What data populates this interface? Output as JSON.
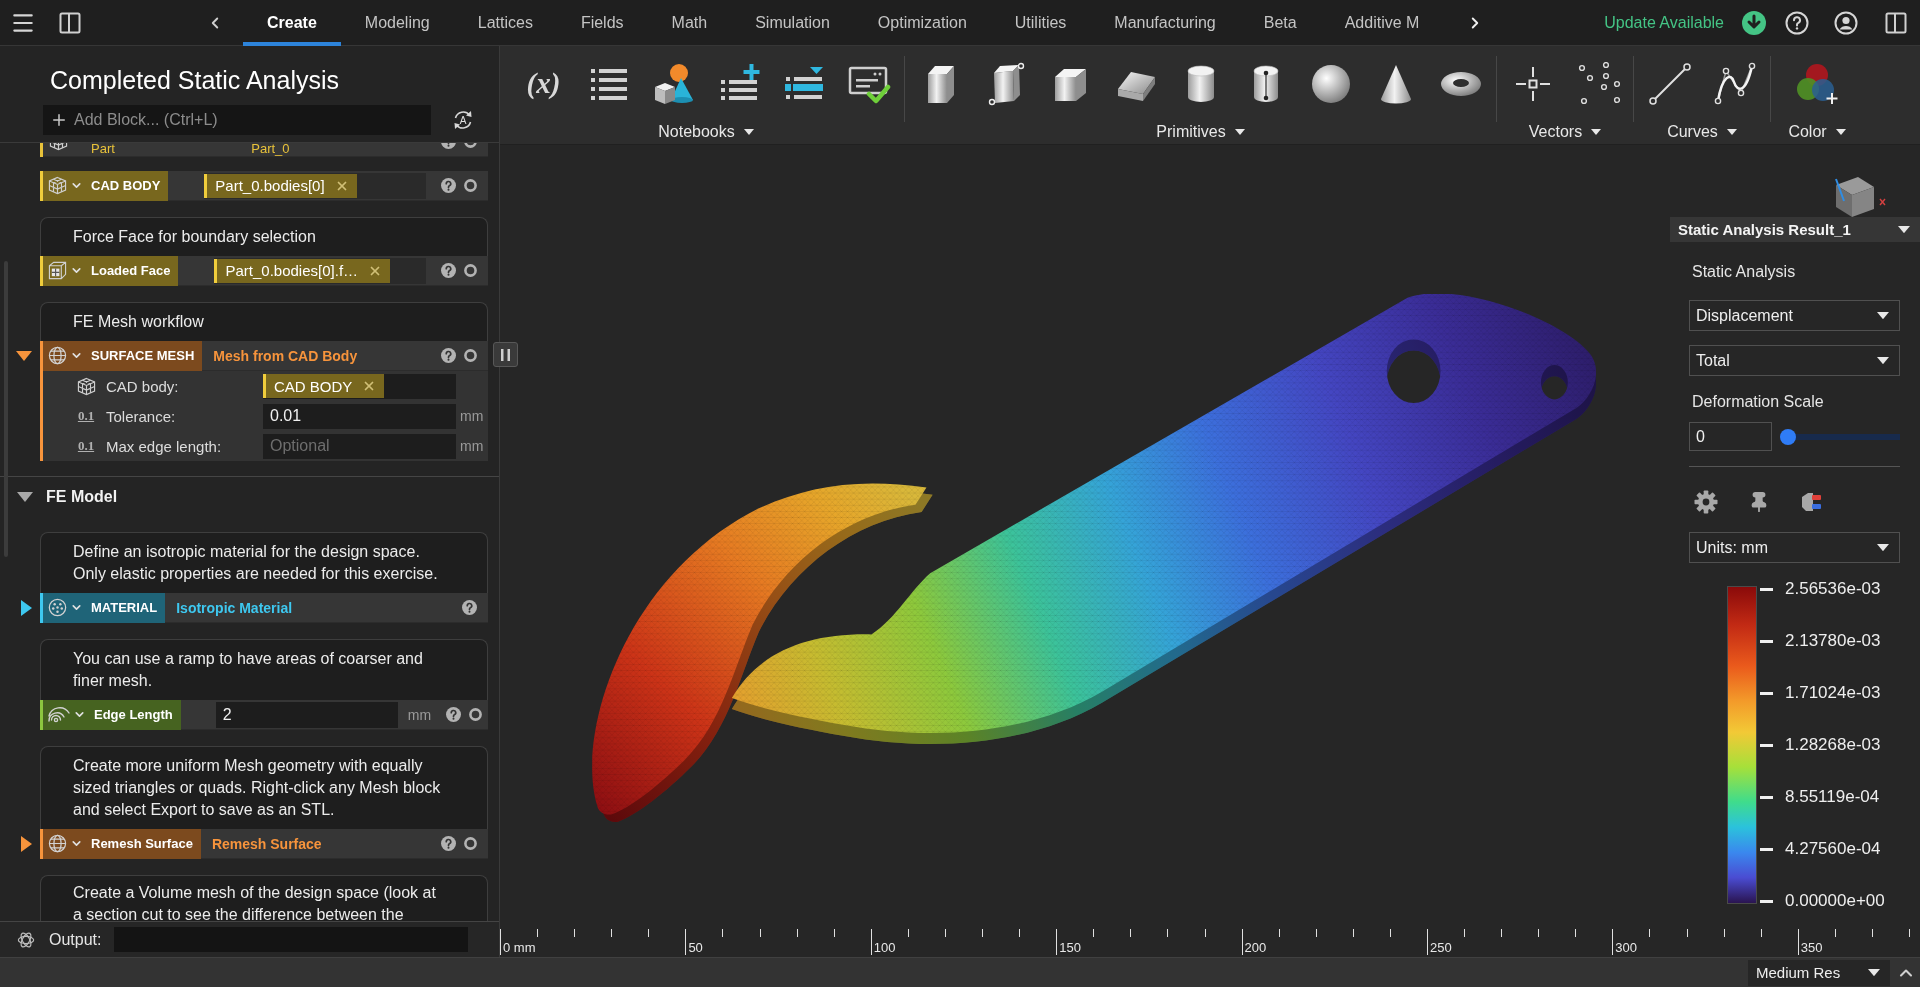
{
  "top_bar": {
    "tabs": [
      {
        "label": "Create",
        "selected": true
      },
      {
        "label": "Modeling",
        "selected": false
      },
      {
        "label": "Lattices",
        "selected": false
      },
      {
        "label": "Fields",
        "selected": false
      },
      {
        "label": "Math",
        "selected": false
      },
      {
        "label": "Simulation",
        "selected": false
      },
      {
        "label": "Optimization",
        "selected": false
      },
      {
        "label": "Utilities",
        "selected": false
      },
      {
        "label": "Manufacturing",
        "selected": false
      },
      {
        "label": "Beta",
        "selected": false
      },
      {
        "label": "Additive M",
        "selected": false
      }
    ],
    "update_label": "Update Available"
  },
  "notebook": {
    "title": "Completed Static Analysis",
    "add_block": {
      "placeholder": "Add Block... (Ctrl+L)"
    },
    "auto_run": {
      "symbol": "A"
    },
    "items": [
      {
        "kind": "block",
        "block": {
          "kind": "output",
          "label": "Part",
          "color": "#e8c23a",
          "value": "Part_0",
          "toggle": true
        }
      },
      {
        "kind": "block",
        "block": {
          "kind": "reference",
          "label": "CAD BODY",
          "color": "#f0cd3c",
          "tag": "Part_0.bodies[0]",
          "toggle": true
        }
      },
      {
        "kind": "block",
        "comment": "Force Face for boundary selection",
        "block": {
          "kind": "reference",
          "label": "Loaded Face",
          "color": "#f0cd3c",
          "tag": "Part_0.bodies[0].f…",
          "toggle": true
        }
      },
      {
        "kind": "block",
        "comment": "FE Mesh workflow",
        "block": {
          "kind": "operation",
          "label": "SURFACE MESH",
          "color": "#f7943c",
          "subtitle": "Mesh from CAD Body",
          "expanded": true,
          "toggle": true,
          "params": [
            {
              "kind": "reference",
              "label": "CAD body:",
              "tag": "CAD BODY",
              "color": "#f0cd3c"
            },
            {
              "kind": "number",
              "symbol": "0.1",
              "label": "Tolerance:",
              "value": "0.01",
              "unit": "mm"
            },
            {
              "kind": "number",
              "symbol": "0.1",
              "label": "Max edge length:",
              "placeholder": "Optional",
              "unit": "mm"
            }
          ]
        }
      },
      {
        "kind": "section",
        "label": "FE Model",
        "expanded": true
      },
      {
        "kind": "block",
        "comment": "Define an isotropic material for the design space. Only elastic properties are needed for this exercise.",
        "block": {
          "kind": "operation",
          "label": "MATERIAL",
          "color": "#3ec8f0",
          "subtitle": "Isotropic Material",
          "expanded": false,
          "toggle": false
        }
      },
      {
        "kind": "block",
        "comment": "You can use a ramp to have areas of coarser and finer mesh.",
        "block": {
          "kind": "number",
          "label": "Edge Length",
          "color": "#8cc63f",
          "value": "2",
          "unit": "mm",
          "toggle": true
        }
      },
      {
        "kind": "block",
        "comment": "Create more uniform Mesh geometry with equally sized triangles or quads. Right-click any Mesh block and select Export to save as an STL.",
        "block": {
          "kind": "operation",
          "label": "Remesh Surface",
          "color": "#f7943c",
          "subtitle": "Remesh Surface",
          "expanded": false,
          "toggle": true
        }
      },
      {
        "kind": "comment",
        "comment": "Create a Volume mesh of the design space (look at a section cut to see the difference between the"
      }
    ]
  },
  "output": {
    "label": "Output:"
  },
  "toolbar": {
    "groups": [
      {
        "label": "Notebooks",
        "symbol": "(x)"
      },
      {
        "label": "Primitives"
      },
      {
        "label": "Vectors"
      },
      {
        "label": "Curves"
      },
      {
        "label": "Color"
      }
    ]
  },
  "result_panel": {
    "title": "Static Analysis Result_1",
    "heading": "Static Analysis",
    "quantity": "Displacement",
    "component": "Total",
    "deformation": {
      "label": "Deformation Scale",
      "value": "0",
      "level": 0
    },
    "units": "Units: mm",
    "legend": [
      "2.56536e-03",
      "2.13780e-03",
      "1.71024e-03",
      "1.28268e-03",
      "8.55119e-04",
      "4.27560e-04",
      "0.00000e+00"
    ]
  },
  "ruler": {
    "labels": [
      "0 mm",
      "50",
      "100",
      "150",
      "200",
      "250",
      "300",
      "350"
    ]
  },
  "status_bar": {
    "resolution": "Medium Res"
  }
}
